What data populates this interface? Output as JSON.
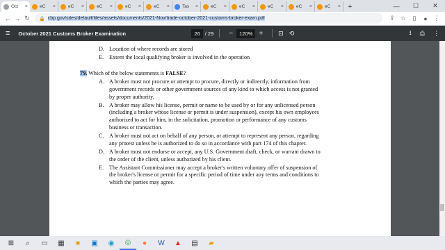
{
  "browser": {
    "tabs": [
      {
        "title": "Oct",
        "active": true,
        "color": "#9aa0a6"
      },
      {
        "title": "eC",
        "active": false,
        "color": "#f29900"
      },
      {
        "title": "eC",
        "active": false,
        "color": "#f29900"
      },
      {
        "title": "eC",
        "active": false,
        "color": "#f29900"
      },
      {
        "title": "eC",
        "active": false,
        "color": "#f29900"
      },
      {
        "title": "eC",
        "active": false,
        "color": "#f29900"
      },
      {
        "title": "Tas",
        "active": false,
        "color": "#4285f4"
      },
      {
        "title": "eC",
        "active": false,
        "color": "#f29900"
      },
      {
        "title": "eC",
        "active": false,
        "color": "#f29900"
      },
      {
        "title": "eC",
        "active": false,
        "color": "#f29900"
      },
      {
        "title": "eC",
        "active": false,
        "color": "#f29900"
      },
      {
        "title": "eC",
        "active": false,
        "color": "#f29900"
      }
    ],
    "url": "cbp.gov/sites/default/files/assets/documents/2021-Nov/trade-october-2021-customs-broker-exam.pdf"
  },
  "pdf": {
    "title": "October 2021 Customs Broker Examination",
    "page_current": "26",
    "page_total": "/ 29",
    "zoom": "120%"
  },
  "document": {
    "prev_options": [
      {
        "letter": "D.",
        "text": "Location of where records are stored"
      },
      {
        "letter": "E.",
        "text": "Extent the local qualifying broker is involved in the operation"
      }
    ],
    "question": {
      "number": "79.",
      "text_before": "Which of the below statements is ",
      "emphasis": "FALSE",
      "text_after": "?"
    },
    "options": [
      {
        "letter": "A.",
        "lines": [
          "A broker must not procure or attempt to procure, directly or indirectly, information from",
          "government records or other government sources of any kind to which access is not granted",
          "by proper authority."
        ]
      },
      {
        "letter": "B.",
        "lines": [
          "A broker may allow his license, permit or name to be used by or for any unlicensed person",
          "(including a broker whose license or permit is under suspension), except his own employees",
          "authorized to act for him, in the solicitation, promotion or performance of any customs",
          "business or transaction."
        ]
      },
      {
        "letter": "C.",
        "lines": [
          "A broker must not act on behalf of any person, or attempt to represent any person, regarding",
          "any protest unless he is authorized to do so in accordance with part 174 of this chapter."
        ]
      },
      {
        "letter": "D.",
        "lines": [
          "A broker must not endorse or accept, any U.S. Government draft, check, or warrant drawn to",
          "the order of the client, unless authorized by his client."
        ]
      },
      {
        "letter": "E.",
        "lines": [
          "The Assistant Commissioner may accept a broker's written voluntary offer of suspension of",
          "the broker's license or permit for a specific period of time under any terms and conditions to",
          "which the parties may agree."
        ]
      }
    ]
  }
}
